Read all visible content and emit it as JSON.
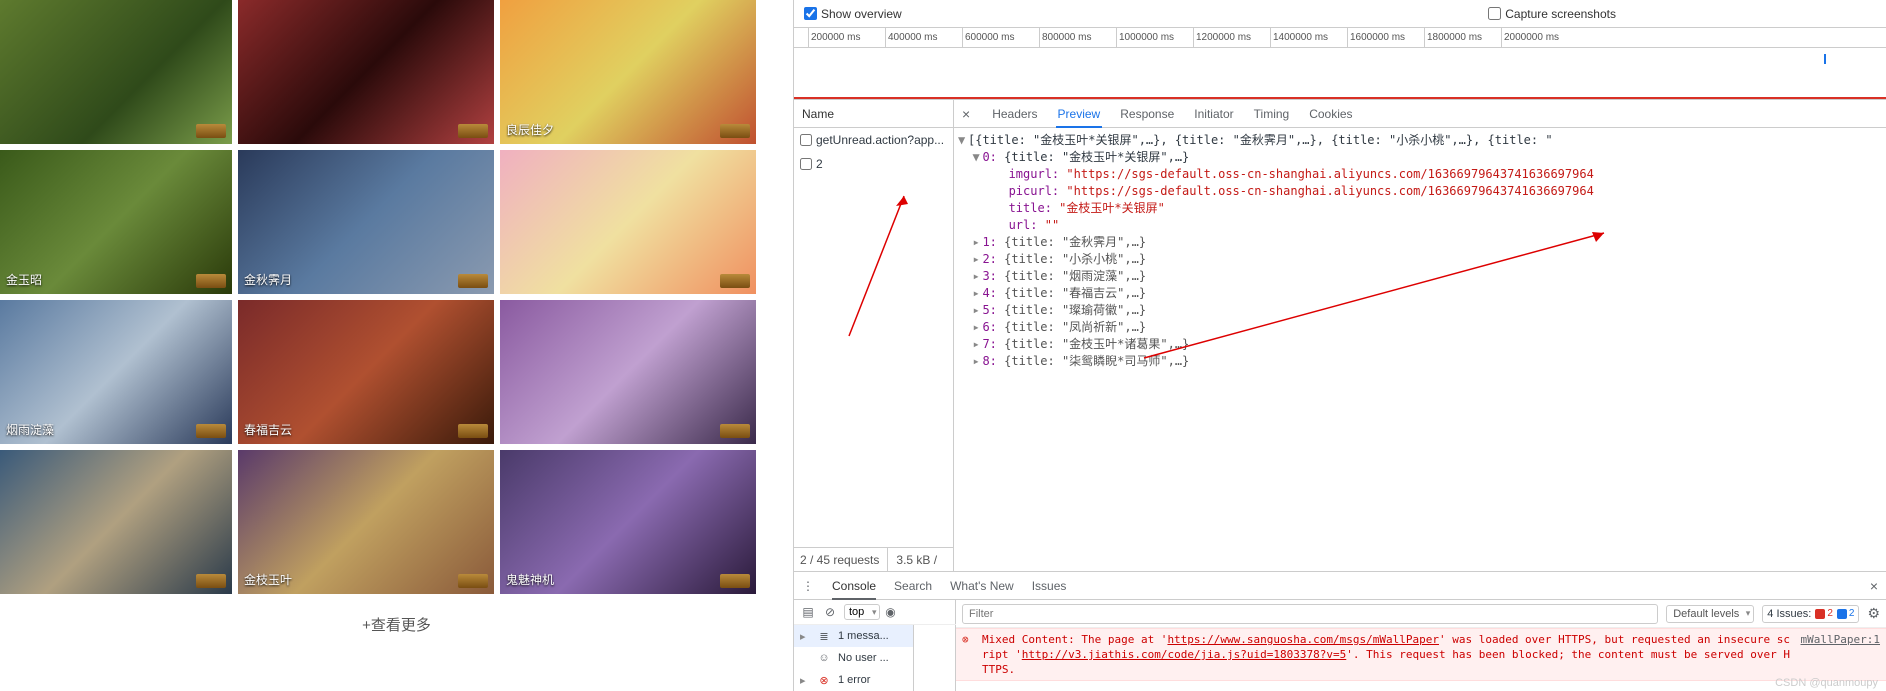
{
  "gallery": {
    "captions": [
      "",
      "",
      "良辰佳夕",
      "金玉昭",
      "金秋霁月",
      "",
      "烟雨淀藻",
      "春福吉云",
      "",
      "",
      "金枝玉叶",
      "鬼魅神机"
    ],
    "more_label": "+查看更多"
  },
  "topbar": {
    "overview_label": "Show overview",
    "overview_checked": true,
    "capture_label": "Capture screenshots",
    "capture_checked": false
  },
  "timeline_ticks": [
    "200000 ms",
    "400000 ms",
    "600000 ms",
    "800000 ms",
    "1000000 ms",
    "1200000 ms",
    "1400000 ms",
    "1600000 ms",
    "1800000 ms",
    "2000000 ms"
  ],
  "network": {
    "name_header": "Name",
    "rows": [
      "getUnread.action?app...",
      "2"
    ],
    "footer_requests": "2 / 45 requests",
    "footer_size": "3.5 kB /"
  },
  "tabs": [
    "Headers",
    "Preview",
    "Response",
    "Initiator",
    "Timing",
    "Cookies"
  ],
  "active_tab": "Preview",
  "preview": {
    "root_summary": "[{title: \"金枝玉叶*关银屏\",…}, {title: \"金秋霁月\",…}, {title: \"小杀小桃\",…}, {title: \"",
    "item0_head": "{title: \"金枝玉叶*关银屏\",…}",
    "imgurl_key": "imgurl:",
    "imgurl_val": "\"https://sgs-default.oss-cn-shanghai.aliyuncs.com/16366979643741636697964",
    "picurl_key": "picurl:",
    "picurl_val": "\"https://sgs-default.oss-cn-shanghai.aliyuncs.com/16366979643741636697964",
    "title_key": "title:",
    "title_val": "\"金枝玉叶*关银屏\"",
    "url_key": "url:",
    "url_val": "\"\"",
    "items": [
      {
        "idx": "1",
        "title": "金秋霁月"
      },
      {
        "idx": "2",
        "title": "小杀小桃"
      },
      {
        "idx": "3",
        "title": "烟雨淀藻"
      },
      {
        "idx": "4",
        "title": "春福吉云"
      },
      {
        "idx": "5",
        "title": "璨瑜荷徽"
      },
      {
        "idx": "6",
        "title": "凤尚祈新"
      },
      {
        "idx": "7",
        "title": "金枝玉叶*诸葛果"
      },
      {
        "idx": "8",
        "title": "柒鸳瞵睨*司马师"
      }
    ]
  },
  "drawer": {
    "tabs": [
      "Console",
      "Search",
      "What's New",
      "Issues"
    ],
    "active": "Console",
    "context": "top",
    "filter_placeholder": "Filter",
    "levels_label": "Default levels",
    "issues_label": "4 Issues:",
    "issues_err": "2",
    "issues_info": "2",
    "sidebar": {
      "messages": "1 messa...",
      "nouser": "No user ...",
      "error": "1 error"
    },
    "msg_prefix": "Mixed Content: The page at '",
    "msg_url1": "https://www.sanguosha.com/msgs/mWallPaper",
    "msg_mid": "' was loaded over HTTPS, but requested an insecure script '",
    "msg_url2": "http://v3.jiathis.com/code/jia.js?uid=1803378?v=5",
    "msg_suffix": "'. This request has been blocked; the content must be served over HTTPS.",
    "msg_src": "mWallPaper:1"
  },
  "watermark": "CSDN @quanmoupy"
}
